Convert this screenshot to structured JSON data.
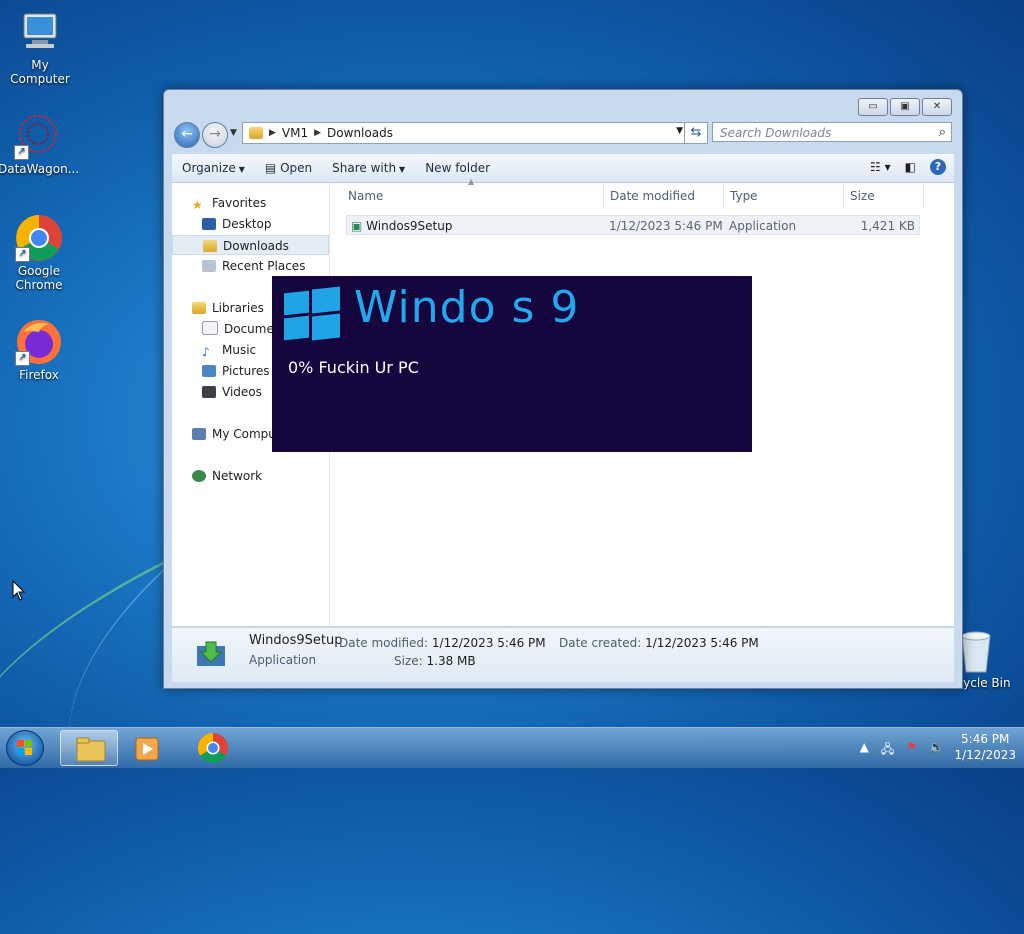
{
  "desktop": {
    "icons": [
      {
        "label": "My Computer"
      },
      {
        "label": "DataWagon..."
      },
      {
        "label": "Google Chrome"
      },
      {
        "label": "Firefox"
      },
      {
        "label": "Recycle Bin"
      }
    ]
  },
  "explorer": {
    "caption_buttons": {
      "minimize": "▭",
      "maximize": "▣",
      "close": "✕"
    },
    "address": {
      "segments": [
        "VM1",
        "Downloads"
      ]
    },
    "search": {
      "placeholder": "Search Downloads"
    },
    "toolbar": {
      "organize": "Organize",
      "open": "Open",
      "share_with": "Share with",
      "new_folder": "New folder",
      "help": "?"
    },
    "nav": {
      "favorites": "Favorites",
      "desktop": "Desktop",
      "downloads": "Downloads",
      "recent_places": "Recent Places",
      "libraries": "Libraries",
      "documents": "Documen",
      "music": "Music",
      "pictures": "Pictures",
      "videos": "Videos",
      "my_computer": "My Compu",
      "network": "Network"
    },
    "columns": {
      "name": "Name",
      "date_modified": "Date modified",
      "type": "Type",
      "size": "Size"
    },
    "files": [
      {
        "name": "Windos9Setup",
        "date_modified": "1/12/2023 5:46 PM",
        "type": "Application",
        "size": "1,421 KB"
      }
    ],
    "details": {
      "name": "Windos9Setup",
      "type": "Application",
      "date_modified_label": "Date modified:",
      "date_modified": "1/12/2023 5:46 PM",
      "size_label": "Size:",
      "size": "1.38 MB",
      "date_created_label": "Date created:",
      "date_created": "1/12/2023 5:46 PM"
    }
  },
  "popup": {
    "title": "Windo    s 9",
    "status": "0% Fuckin Ur PC",
    "bg_color": "#15063e",
    "accent_color": "#1fa4e8"
  },
  "taskbar": {
    "clock_time": "5:46 PM",
    "clock_date": "1/12/2023"
  }
}
